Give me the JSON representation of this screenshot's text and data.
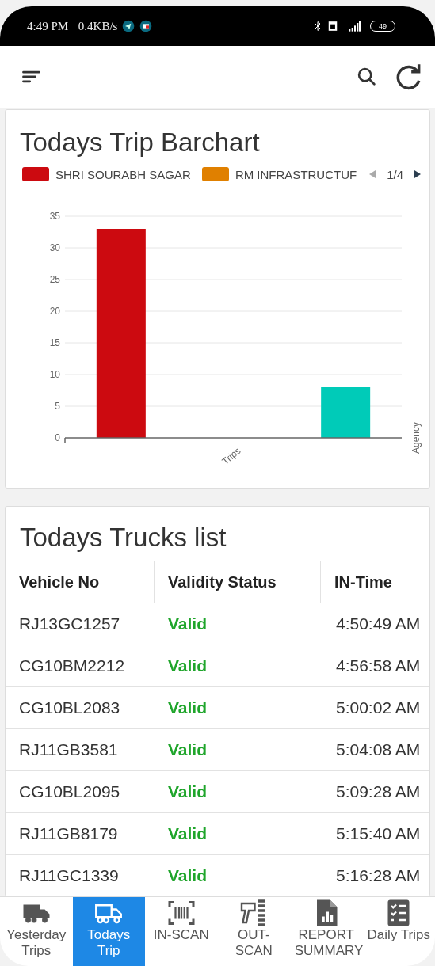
{
  "status_bar": {
    "time": "4:49 PM",
    "speed": "| 0.4KB/s",
    "battery": "49"
  },
  "chart_card": {
    "title": "Todays Trip Barchart",
    "legend_page": "1/4",
    "axis_name": "Agency",
    "chart_data": {
      "type": "bar",
      "categories": [
        "Trips"
      ],
      "grid": true,
      "yticks": [
        0,
        5,
        10,
        15,
        20,
        25,
        30,
        35
      ],
      "ylim": [
        0,
        35
      ],
      "series": [
        {
          "name": "SHRI SOURABH SAGAR",
          "color": "#cc0a10",
          "values": [
            33
          ]
        },
        {
          "name": "RM INFRASTRUCTUF",
          "color": "#e08000",
          "values": [
            0
          ]
        },
        {
          "color": "#00cbb8",
          "values": [
            8
          ]
        }
      ]
    }
  },
  "trucks": {
    "title": "Todays Trucks list",
    "columns": [
      "Vehicle No",
      "Validity Status",
      "IN-Time"
    ],
    "rows": [
      {
        "vehicle": "RJ13GC1257",
        "status": "Valid",
        "time": "4:50:49 AM"
      },
      {
        "vehicle": "CG10BM2212",
        "status": "Valid",
        "time": "4:56:58 AM"
      },
      {
        "vehicle": "CG10BL2083",
        "status": "Valid",
        "time": "5:00:02 AM"
      },
      {
        "vehicle": "RJ11GB3581",
        "status": "Valid",
        "time": "5:04:08 AM"
      },
      {
        "vehicle": "CG10BL2095",
        "status": "Valid",
        "time": "5:09:28 AM"
      },
      {
        "vehicle": "RJ11GB8179",
        "status": "Valid",
        "time": "5:15:40 AM"
      },
      {
        "vehicle": "RJ11GC1339",
        "status": "Valid",
        "time": "5:16:28 AM"
      }
    ]
  },
  "bottom_nav": [
    {
      "label": "Yesterday Trips",
      "kind": "truck",
      "selected": false
    },
    {
      "label": "Todays Trip",
      "kind": "truck",
      "selected": true
    },
    {
      "label": "IN-SCAN",
      "kind": "barcode",
      "selected": false
    },
    {
      "label": "OUT-SCAN",
      "kind": "scanner",
      "selected": false
    },
    {
      "label": "REPORT SUMMARY",
      "kind": "report",
      "selected": false
    },
    {
      "label": "Daily Trips",
      "kind": "checklist",
      "selected": false
    }
  ]
}
